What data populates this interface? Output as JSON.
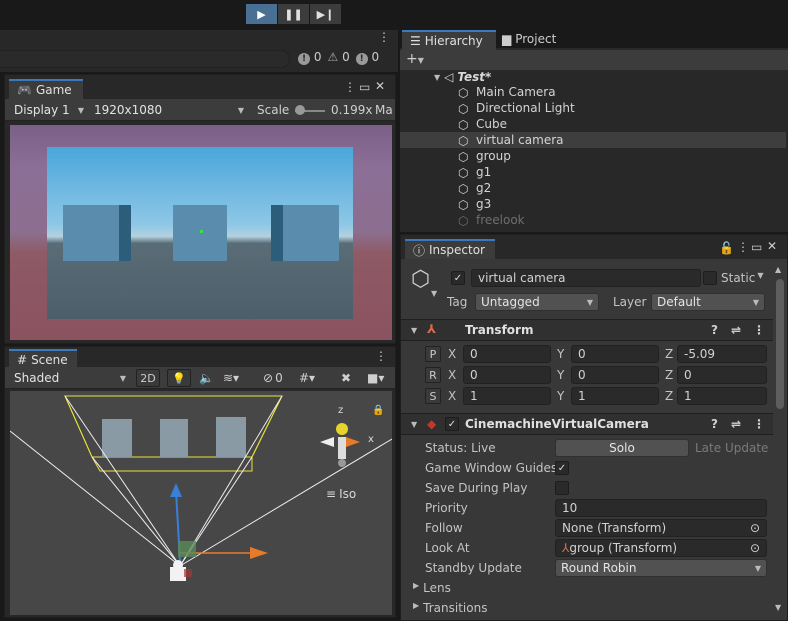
{
  "toolbar": {
    "play_icon": "play-icon",
    "pause_icon": "pause-icon",
    "step_icon": "step-icon",
    "accent": "#4a6f95"
  },
  "console": {
    "errors": "0",
    "warnings": "0",
    "logs": "0"
  },
  "game": {
    "tab": "Game",
    "display": "Display 1",
    "resolution": "1920x1080",
    "scale_label": "Scale",
    "scale_value": "0.199x",
    "next_label": "Ma"
  },
  "scene": {
    "tab": "Scene",
    "shading": "Shaded",
    "mode_2d": "2D",
    "hidden_count": "0",
    "iso_label": "Iso",
    "gizmo_x": "x",
    "gizmo_z": "z"
  },
  "hierarchy": {
    "tab": "Hierarchy",
    "project_tab": "Project",
    "scene_name": "Test*",
    "items": [
      {
        "label": "Main Camera"
      },
      {
        "label": "Directional Light"
      },
      {
        "label": "Cube"
      },
      {
        "label": "virtual camera"
      },
      {
        "label": "group"
      },
      {
        "label": "g1"
      },
      {
        "label": "g2"
      },
      {
        "label": "g3"
      },
      {
        "label": "freelook"
      }
    ]
  },
  "inspector": {
    "tab": "Inspector",
    "object_name": "virtual camera",
    "static_label": "Static",
    "tag_label": "Tag",
    "tag_value": "Untagged",
    "layer_label": "Layer",
    "layer_value": "Default",
    "transform": {
      "title": "Transform",
      "rows": [
        {
          "btn": "P",
          "x": "0",
          "y": "0",
          "z": "-5.09"
        },
        {
          "btn": "R",
          "x": "0",
          "y": "0",
          "z": "0"
        },
        {
          "btn": "S",
          "x": "1",
          "y": "1",
          "z": "1"
        }
      ],
      "x_label": "X",
      "y_label": "Y",
      "z_label": "Z"
    },
    "cinemachine": {
      "title": "CinemachineVirtualCamera",
      "status_label": "Status: Live",
      "solo_label": "Solo",
      "late_update": "Late Update",
      "guides_label": "Game Window Guides",
      "save_label": "Save During Play",
      "priority_label": "Priority",
      "priority_value": "10",
      "follow_label": "Follow",
      "follow_value": "None (Transform)",
      "lookat_label": "Look At",
      "lookat_value": "group (Transform)",
      "standby_label": "Standby Update",
      "standby_value": "Round Robin",
      "lens_label": "Lens",
      "transitions_label": "Transitions"
    }
  }
}
